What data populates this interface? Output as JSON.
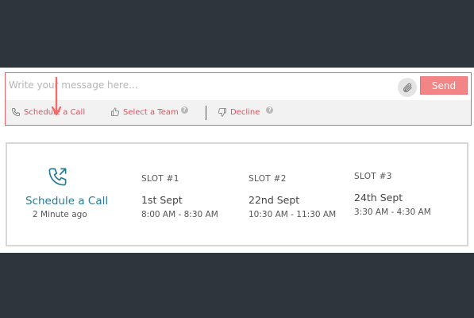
{
  "composer": {
    "placeholder": "Write your message here...",
    "send_label": "Send",
    "actions": [
      {
        "label": "Schedule a Call"
      },
      {
        "label": "Select a Team",
        "help": "?"
      },
      {
        "label": "Decline",
        "help": "?"
      }
    ]
  },
  "card": {
    "title": "Schedule a Call",
    "time": "2 Minute ago",
    "slots": [
      {
        "label": "SLOT  #1",
        "date": "1st  Sept",
        "time": "8:00 AM - 8:30 AM"
      },
      {
        "label": "SLOT  #2",
        "date": "22nd Sept",
        "time": "10:30 AM - 11:30 AM"
      },
      {
        "label": "SLOT  #3",
        "date": "24th Sept",
        "time": "3:30 AM - 4:30 AM"
      }
    ]
  },
  "colors": {
    "background": "#2f353c",
    "accent_red": "#e3505a",
    "send_button": "#f28585",
    "teal": "#2a7a94"
  },
  "icons": {
    "attach": "paperclip-icon",
    "schedule": "phone-icon",
    "team": "thumbs-up-icon",
    "decline": "thumbs-down-icon",
    "card": "phone-outgoing-icon",
    "pointer": "arrow-down-icon"
  }
}
